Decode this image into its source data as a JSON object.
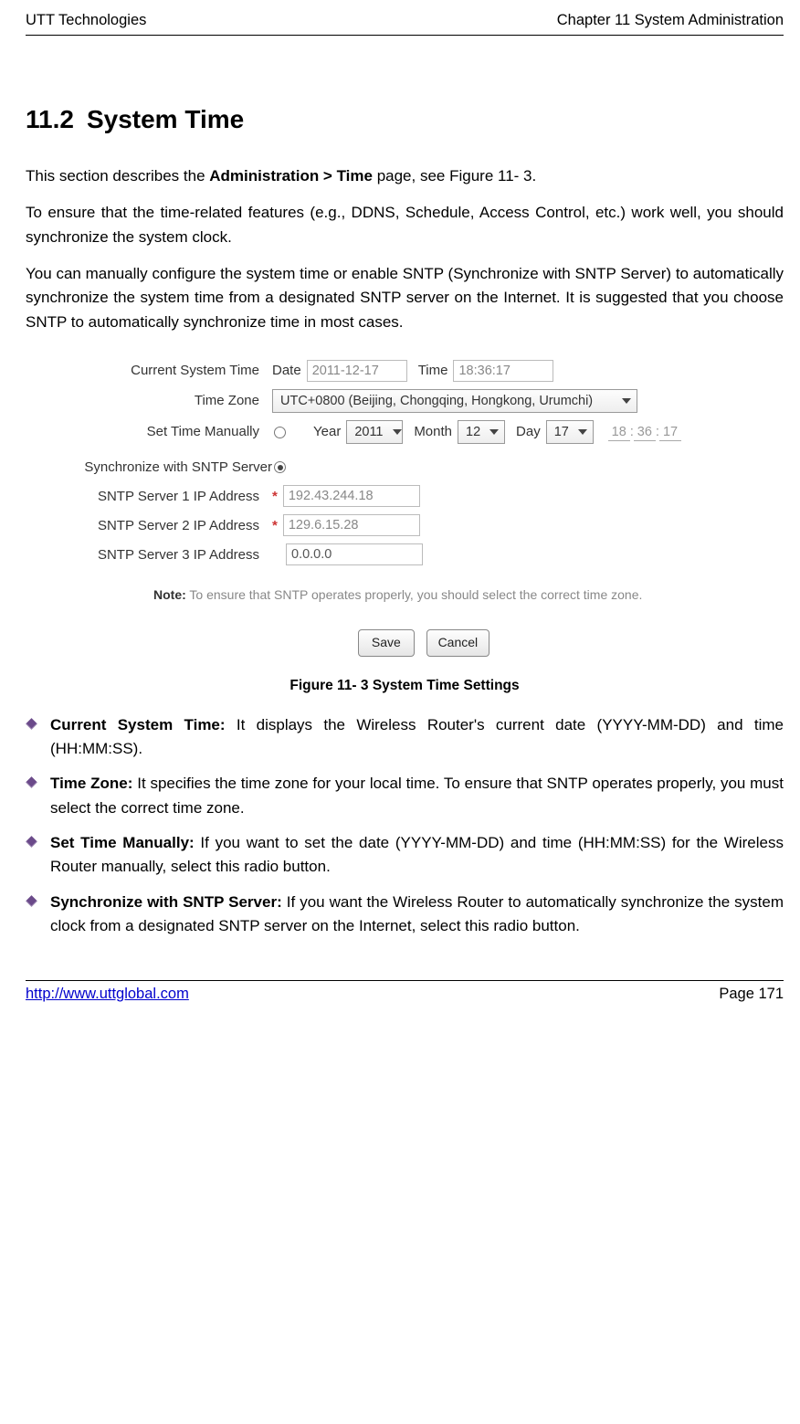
{
  "header": {
    "left": "UTT Technologies",
    "right": "Chapter 11 System Administration"
  },
  "section": {
    "number": "11.2",
    "title": "System Time"
  },
  "paras": {
    "p1a": "This section describes the ",
    "p1b_bold": "Administration > Time",
    "p1c": " page, see Figure 11- 3.",
    "p2": "To ensure that the time-related features (e.g., DDNS, Schedule, Access Control, etc.) work well, you should synchronize the system clock.",
    "p3": "You can manually configure the system time or enable SNTP (Synchronize with SNTP Server) to automatically synchronize the system time from a designated SNTP server on the Internet. It is suggested that you choose SNTP to automatically synchronize time in most cases."
  },
  "form": {
    "labels": {
      "current": "Current System Time",
      "date": "Date",
      "time": "Time",
      "tz": "Time Zone",
      "manual": "Set Time Manually",
      "year": "Year",
      "month": "Month",
      "day": "Day",
      "sntp": "Synchronize with SNTP Server",
      "s1": "SNTP Server 1 IP Address",
      "s2": "SNTP Server 2 IP Address",
      "s3": "SNTP Server 3 IP Address"
    },
    "values": {
      "date": "2011-12-17",
      "time": "18:36:17",
      "tz": "UTC+0800 (Beijing, Chongqing, Hongkong, Urumchi)",
      "year": "2011",
      "month": "12",
      "day": "17",
      "hh": "18",
      "mm": "36",
      "ss": "17",
      "s1": "192.43.244.18",
      "s2": "129.6.15.28",
      "s3": "0.0.0.0"
    },
    "note_label": "Note:",
    "note_text": " To ensure that SNTP operates properly, you should select the correct time zone.",
    "buttons": {
      "save": "Save",
      "cancel": "Cancel"
    }
  },
  "caption": "Figure 11- 3 System Time Settings",
  "bullets": {
    "b1_label": "Current System Time:",
    "b1_text": " It displays the Wireless Router's current date (YYYY-MM-DD) and time (HH:MM:SS).",
    "b2_label": "Time Zone:",
    "b2_text": " It specifies the time zone for your local time. To ensure that SNTP operates properly, you must select the correct time zone.",
    "b3_label": "Set Time Manually:",
    "b3_text": " If you want to set the date (YYYY-MM-DD) and time (HH:MM:SS) for the Wireless Router manually, select this radio button.",
    "b4_label": "Synchronize with SNTP Server:",
    "b4_text": " If you want the Wireless Router to automatically synchronize the system clock from a designated SNTP server on the Internet, select this radio button."
  },
  "footer": {
    "url": "http://www.uttglobal.com",
    "page": "Page 171"
  }
}
